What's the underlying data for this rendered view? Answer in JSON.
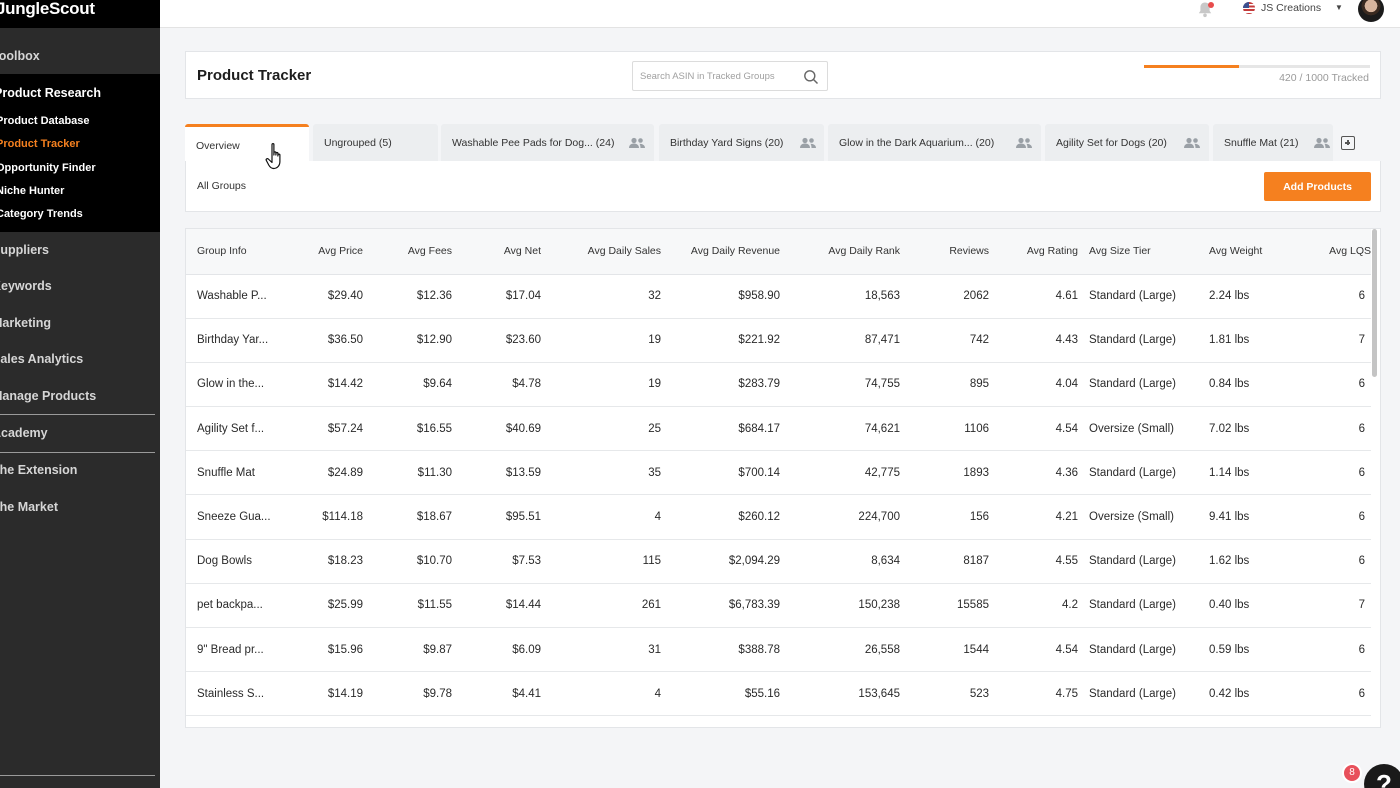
{
  "sidebar": {
    "logo": "JungleScout",
    "toolbox": "Toolbox",
    "product_research": {
      "title": "Product Research",
      "items": [
        "Product Database",
        "Product Tracker",
        "Opportunity Finder",
        "Niche Hunter",
        "Category Trends"
      ]
    },
    "sections": [
      "Suppliers",
      "Keywords",
      "Marketing",
      "Sales Analytics",
      "Manage Products",
      "Academy",
      "The Extension",
      "The Market"
    ]
  },
  "topbar": {
    "account_name": "JS Creations"
  },
  "header": {
    "title": "Product Tracker",
    "search_placeholder": "Search ASIN in Tracked Groups",
    "tracked_text": "420 / 1000 Tracked",
    "tracked_fraction": 0.42
  },
  "tabs": [
    {
      "label": "Overview"
    },
    {
      "label": "Ungrouped (5)"
    },
    {
      "label": "Washable Pee Pads for Dog... (24)"
    },
    {
      "label": "Birthday Yard Signs (20)"
    },
    {
      "label": "Glow in the Dark Aquarium... (20)"
    },
    {
      "label": "Agility Set for Dogs (20)"
    },
    {
      "label": "Snuffle Mat (21)"
    }
  ],
  "groups_bar": {
    "label": "All Groups",
    "add_button": "Add Products"
  },
  "table": {
    "headers": [
      "Group Info",
      "Avg Price",
      "Avg Fees",
      "Avg Net",
      "Avg Daily Sales",
      "Avg Daily Revenue",
      "Avg Daily Rank",
      "Reviews",
      "Avg Rating",
      "Avg Size Tier",
      "Avg Weight",
      "Avg LQS"
    ],
    "rows": [
      [
        "Washable P...",
        "$29.40",
        "$12.36",
        "$17.04",
        "32",
        "$958.90",
        "18,563",
        "2062",
        "4.61",
        "Standard (Large)",
        "2.24 lbs",
        "6"
      ],
      [
        "Birthday Yar...",
        "$36.50",
        "$12.90",
        "$23.60",
        "19",
        "$221.92",
        "87,471",
        "742",
        "4.43",
        "Standard (Large)",
        "1.81 lbs",
        "7"
      ],
      [
        "Glow in the...",
        "$14.42",
        "$9.64",
        "$4.78",
        "19",
        "$283.79",
        "74,755",
        "895",
        "4.04",
        "Standard (Large)",
        "0.84 lbs",
        "6"
      ],
      [
        "Agility Set f...",
        "$57.24",
        "$16.55",
        "$40.69",
        "25",
        "$684.17",
        "74,621",
        "1106",
        "4.54",
        "Oversize (Small)",
        "7.02 lbs",
        "6"
      ],
      [
        "Snuffle Mat",
        "$24.89",
        "$11.30",
        "$13.59",
        "35",
        "$700.14",
        "42,775",
        "1893",
        "4.36",
        "Standard (Large)",
        "1.14 lbs",
        "6"
      ],
      [
        "Sneeze Gua...",
        "$114.18",
        "$18.67",
        "$95.51",
        "4",
        "$260.12",
        "224,700",
        "156",
        "4.21",
        "Oversize (Small)",
        "9.41 lbs",
        "6"
      ],
      [
        "Dog Bowls",
        "$18.23",
        "$10.70",
        "$7.53",
        "115",
        "$2,094.29",
        "8,634",
        "8187",
        "4.55",
        "Standard (Large)",
        "1.62 lbs",
        "6"
      ],
      [
        "pet backpa...",
        "$25.99",
        "$11.55",
        "$14.44",
        "261",
        "$6,783.39",
        "150,238",
        "15585",
        "4.2",
        "Standard (Large)",
        "0.40 lbs",
        "7"
      ],
      [
        "9\" Bread pr...",
        "$15.96",
        "$9.87",
        "$6.09",
        "31",
        "$388.78",
        "26,558",
        "1544",
        "4.54",
        "Standard (Large)",
        "0.59 lbs",
        "6"
      ],
      [
        "Stainless S...",
        "$14.19",
        "$9.78",
        "$4.41",
        "4",
        "$55.16",
        "153,645",
        "523",
        "4.75",
        "Standard (Large)",
        "0.42 lbs",
        "6"
      ]
    ]
  },
  "help": {
    "badge": "8",
    "icon_label": "?"
  }
}
